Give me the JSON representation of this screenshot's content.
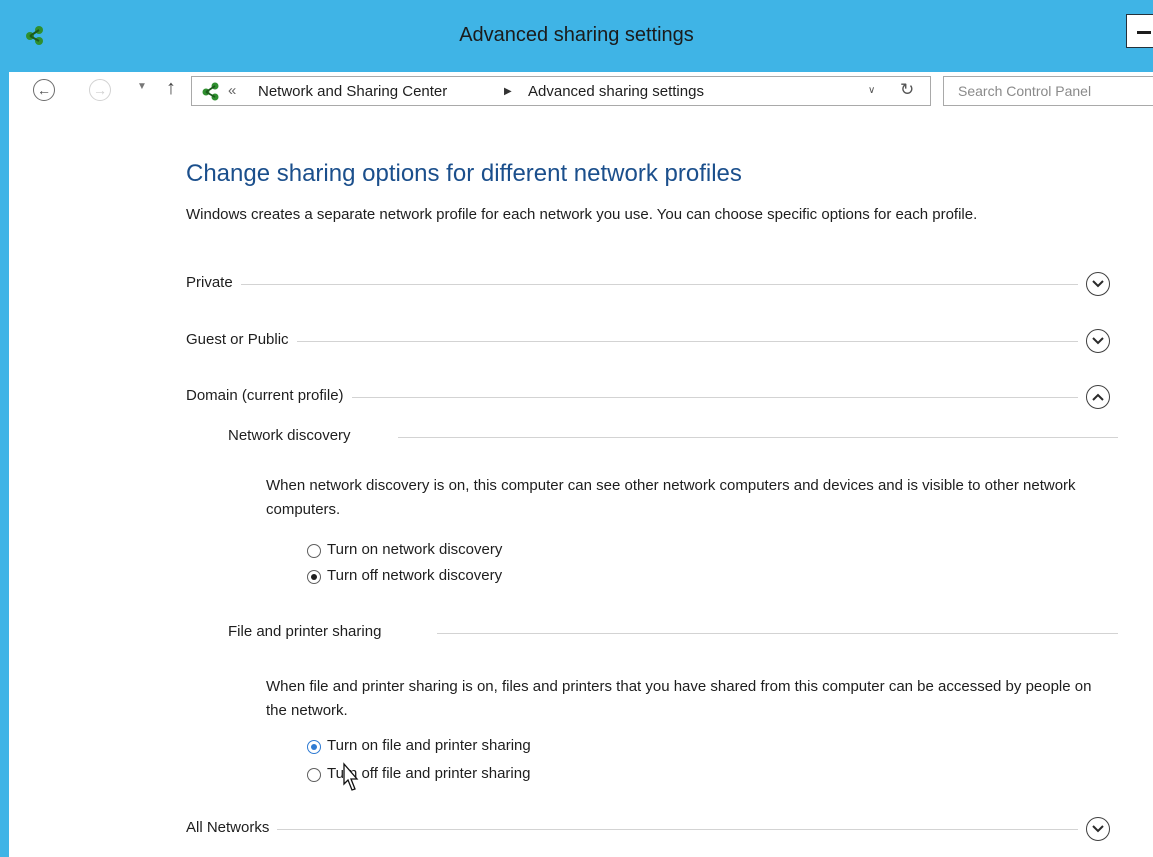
{
  "window": {
    "title": "Advanced sharing settings",
    "accent_color": "#3fb4e6"
  },
  "nav": {
    "back_icon": "back-arrow-icon",
    "forward_icon": "forward-arrow-icon",
    "up_icon": "up-arrow-icon"
  },
  "address": {
    "overflow_glyph": "«",
    "breadcrumbs": [
      "Network and Sharing Center",
      "Advanced sharing settings"
    ],
    "separator": "▶"
  },
  "search": {
    "placeholder": "Search Control Panel"
  },
  "main": {
    "heading": "Change sharing options for different network profiles",
    "intro": "Windows creates a separate network profile for each network you use. You can choose specific options for each profile.",
    "heading_color": "#1b4f8c"
  },
  "profiles": [
    {
      "label": "Private",
      "expanded": false
    },
    {
      "label": "Guest or Public",
      "expanded": false
    },
    {
      "label": "Domain (current profile)",
      "expanded": true
    },
    {
      "label": "All Networks",
      "expanded": false
    }
  ],
  "network_discovery": {
    "title": "Network discovery",
    "description": "When network discovery is on, this computer can see other network computers and devices and is visible to other network computers.",
    "options": [
      {
        "label": "Turn on network discovery",
        "selected": false
      },
      {
        "label": "Turn off network discovery",
        "selected": true
      }
    ]
  },
  "file_sharing": {
    "title": "File and printer sharing",
    "description": "When file and printer sharing is on, files and printers that you have shared from this computer can be accessed by people on the network.",
    "options": [
      {
        "label": "Turn on file and printer sharing",
        "selected": true
      },
      {
        "label": "Turn off file and printer sharing",
        "selected": false
      }
    ]
  }
}
